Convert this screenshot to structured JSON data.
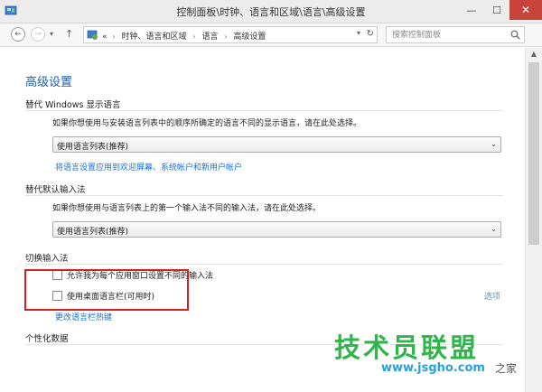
{
  "window": {
    "title": "控制面板\\时钟、语言和区域\\语言\\高级设置",
    "minimize": "—",
    "maximize": "☐",
    "close": "✕"
  },
  "addressbar": {
    "back": "←",
    "forward": "→",
    "recent": "▾",
    "up": "↑",
    "overflow": "«",
    "breadcrumbs": [
      "时钟、语言和区域",
      "语言",
      "高级设置"
    ],
    "separator": "›",
    "dropdown": "▾",
    "refresh": "↻",
    "search_placeholder": "搜索控制面板"
  },
  "main": {
    "title": "高级设置",
    "display_language": {
      "heading": "替代 Windows 显示语言",
      "description": "如果你想使用与安装语言列表中的顺序所确定的语言不同的显示语言，请在此处选择。",
      "select_value": "使用语言列表(推荐)",
      "link": "将语言设置应用到欢迎屏幕、系统帐户和新用户帐户"
    },
    "input_method": {
      "heading": "替代默认输入法",
      "description": "如果你想使用与语言列表上的第一个输入法不同的输入法，请在此处选择。",
      "select_value": "使用语言列表(推荐)"
    },
    "switching": {
      "heading": "切换输入法",
      "checkbox1": "允许我为每个应用窗口设置不同的输入法",
      "checkbox2": "使用桌面语言栏(可用时)",
      "options_link": "选项",
      "hotkeys_link": "更改语言栏热键"
    },
    "personalization": {
      "heading": "个性化数据"
    },
    "select_arrow": "⌄"
  },
  "watermark": {
    "main": "技术员联盟",
    "url": "www.jsgho.com",
    "sub": "之家"
  }
}
